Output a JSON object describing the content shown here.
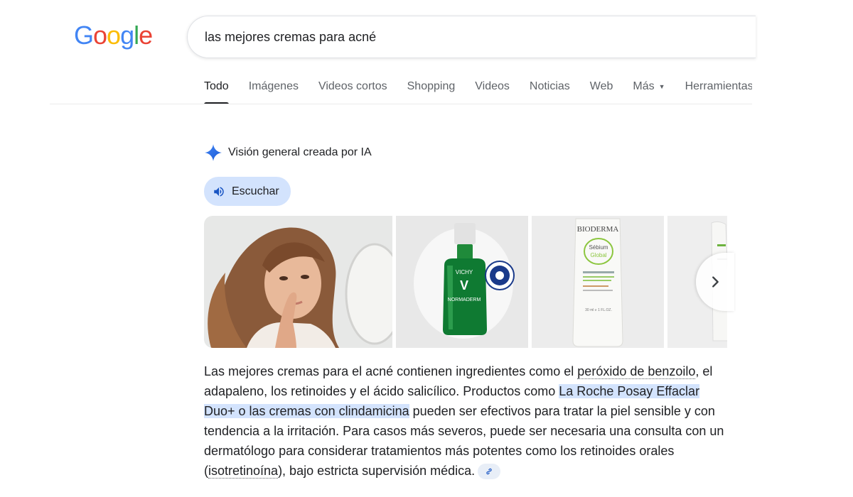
{
  "logo": {
    "letters": [
      "G",
      "o",
      "o",
      "g",
      "l",
      "e"
    ],
    "colors": [
      "#4285F4",
      "#EA4335",
      "#FBBC05",
      "#4285F4",
      "#34A853",
      "#EA4335"
    ]
  },
  "search": {
    "query": "las mejores cremas para acné"
  },
  "tabs": [
    {
      "label": "Todo",
      "active": true
    },
    {
      "label": "Imágenes"
    },
    {
      "label": "Videos cortos"
    },
    {
      "label": "Shopping"
    },
    {
      "label": "Videos"
    },
    {
      "label": "Noticias"
    },
    {
      "label": "Web"
    },
    {
      "label": "Más",
      "caret": "▼"
    },
    {
      "label": "Herramientas"
    }
  ],
  "ai_overview": {
    "title": "Visión general creada por IA",
    "listen_label": "Escuchar",
    "icon": "gemini-sparkle-icon",
    "accent_color": "#4285F4",
    "chip_color": "#d3e3fd"
  },
  "images": {
    "product_vichy": {
      "brand": "VICHY",
      "logo_letter": "V",
      "name": "NORMADERM"
    },
    "product_bioderma": {
      "brand": "BIODERMA",
      "line1": "Sébium",
      "line2": "Global",
      "volume": "30 ml ℮ 1 FL.OZ."
    }
  },
  "summary": {
    "p1": "Las mejores cremas para el acné contienen ingredientes como el ",
    "link1": "peróxido de benzoilo",
    "p2": ", el adapaleno, los retinoides y el ácido salicílico. Productos como ",
    "highlight": "La Roche Posay Effaclar Duo+ o las cremas con clindamicina",
    "p3": " pueden ser efectivos para tratar la piel sensible y con tendencia a la irritación. Para casos más severos, puede ser necesaria una consulta con un dermatólogo para considerar tratamientos más potentes como los retinoides orales (",
    "link2": "isotretinoína",
    "p4": "), bajo estricta supervisión médica."
  }
}
